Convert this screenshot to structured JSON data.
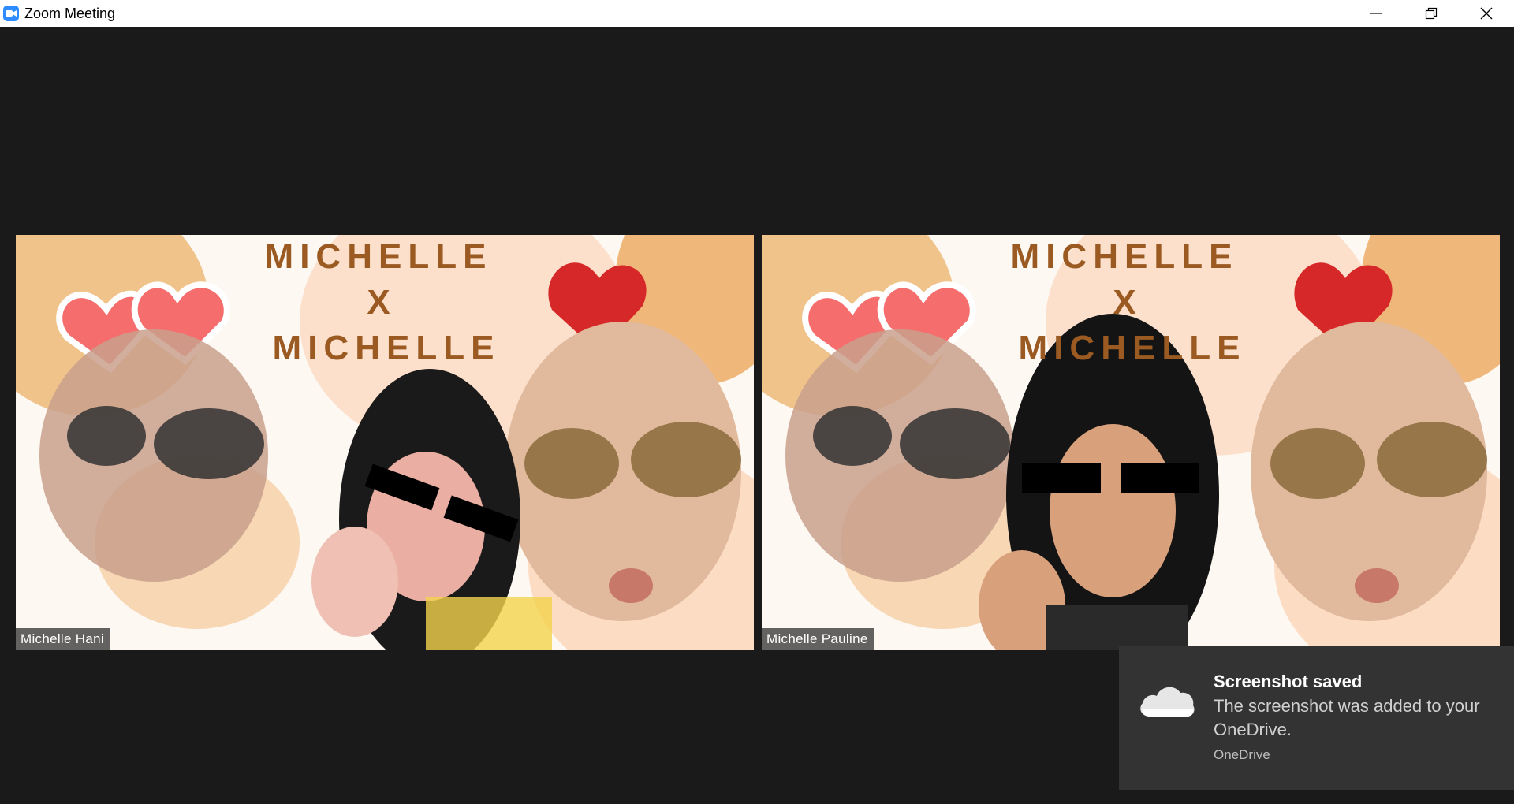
{
  "window": {
    "title": "Zoom Meeting",
    "icon": "zoom-video-icon",
    "controls": [
      "minimize-icon",
      "restore-icon",
      "close-icon"
    ]
  },
  "participants": [
    {
      "name": "Michelle Hani",
      "background_text": [
        "MICHELLE",
        "X",
        "MICHELLE"
      ]
    },
    {
      "name": "Michelle Pauline",
      "background_text": [
        "MICHELLE",
        "X",
        "MICHELLE"
      ]
    }
  ],
  "toast": {
    "title": "Screenshot saved",
    "body": "The screenshot was added to your OneDrive.",
    "source": "OneDrive",
    "icon": "onedrive-cloud-icon"
  },
  "colors": {
    "stage_bg": "#1a1a1a",
    "toast_bg": "#333333",
    "accent_brown": "#9a5a22",
    "heart_red": "#d62828",
    "heart_pink": "#f56d6d"
  }
}
